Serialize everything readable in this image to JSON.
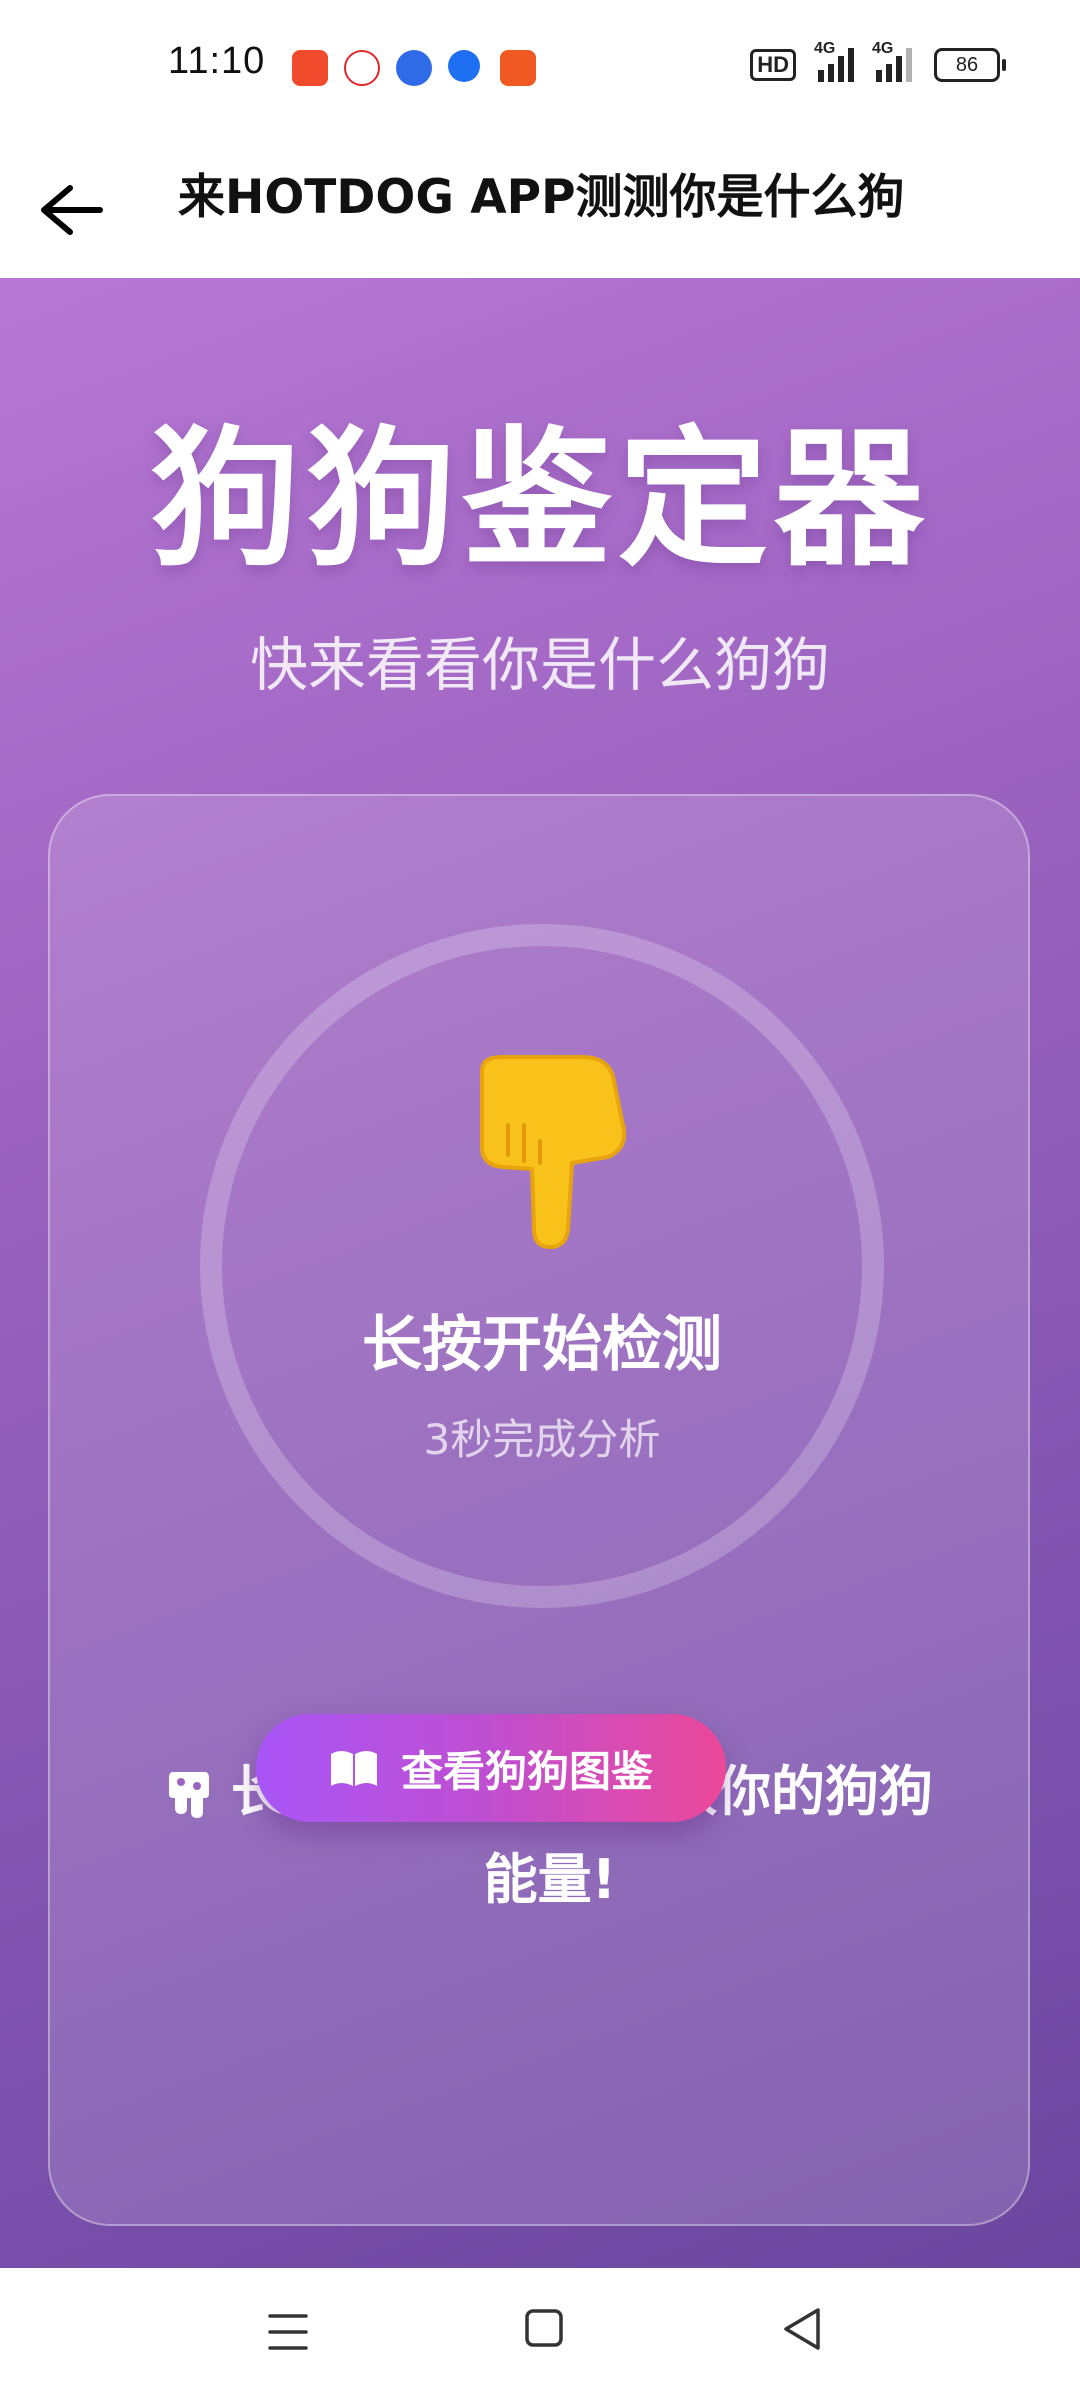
{
  "status_bar": {
    "time": "11:10",
    "hd_label": "HD",
    "signal_1_label": "4G",
    "signal_2_label": "4G",
    "battery": "86"
  },
  "header": {
    "title": "来HOTDOG APP测测你是什么狗"
  },
  "main": {
    "title": "狗狗鉴定器",
    "subtitle": "快来看看你是什么狗狗",
    "press_label": "长按开始检测",
    "press_sublabel": "3秒完成分析",
    "hint_line1": "长按中央区域，释放你的狗狗",
    "hint_line2": "能量!",
    "album_button_label": "查看狗狗图鉴"
  },
  "colors": {
    "gradient_start": "#b678d4",
    "gradient_end": "#6b469f",
    "button_start": "#a855f7",
    "button_end": "#ec4899"
  },
  "icons": {
    "back": "arrow-left-icon",
    "pointer": "pointing-down-hand-icon",
    "hint": "drip-icon",
    "album": "open-book-icon",
    "nav_menu": "menu-icon",
    "nav_home": "square-home-icon",
    "nav_back": "triangle-back-icon"
  }
}
